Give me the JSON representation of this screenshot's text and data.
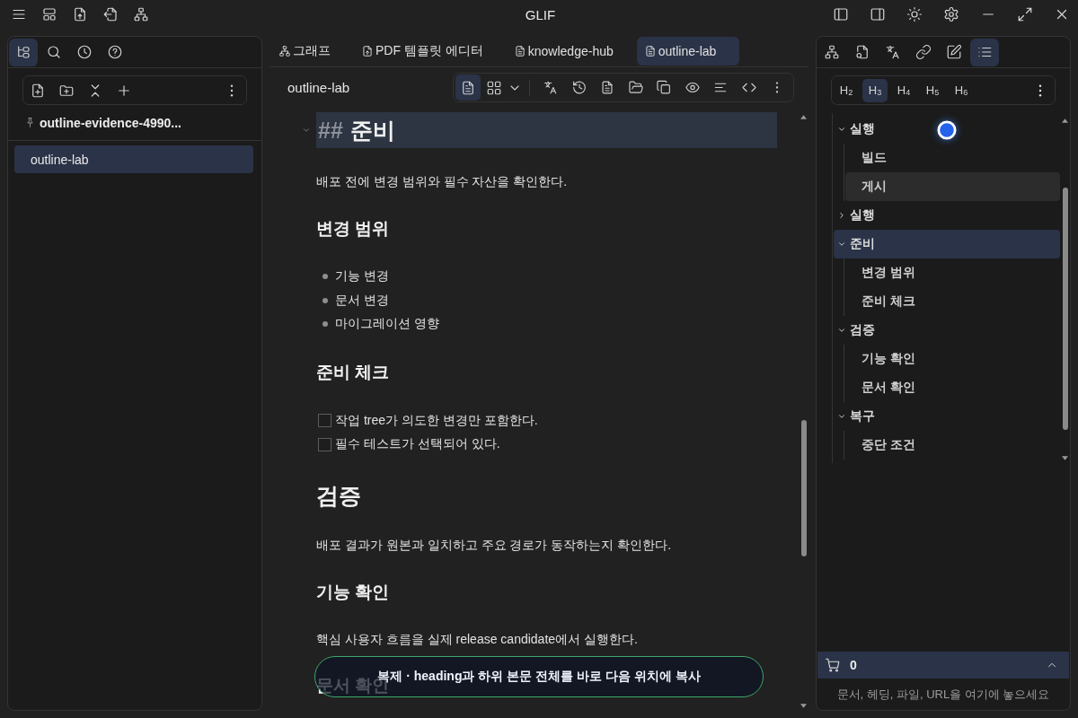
{
  "window": {
    "title": "GLIF"
  },
  "left_panel": {
    "tabs": [
      {
        "selected": true
      },
      {
        "selected": false
      },
      {
        "selected": false
      },
      {
        "selected": false
      }
    ],
    "pinned": "outline-evidence-4990...",
    "files": [
      {
        "label": "outline-lab",
        "selected": true
      }
    ]
  },
  "editor_tabs": [
    {
      "label": "그래프",
      "selected": false
    },
    {
      "label": "PDF 템플릿 에디터",
      "selected": false
    },
    {
      "label": "knowledge-hub",
      "selected": false
    },
    {
      "label": "outline-lab",
      "selected": true
    }
  ],
  "editor": {
    "title": "outline-lab",
    "view_modes": [
      {
        "selected": true
      },
      {
        "selected": false
      }
    ],
    "blocks": [
      {
        "kind": "h2",
        "marker": "##",
        "text": "준비",
        "active": true
      },
      {
        "kind": "paragraph",
        "text": "배포 전에 변경 범위와 필수 자산을 확인한다."
      },
      {
        "kind": "h3",
        "text": "변경 범위",
        "active": false
      },
      {
        "kind": "bullets",
        "items": [
          "기능 변경",
          "문서 변경",
          "마이그레이션 영향"
        ]
      },
      {
        "kind": "h3",
        "text": "준비 체크",
        "active": false
      },
      {
        "kind": "tasks",
        "items": [
          {
            "text": "작업 tree가 의도한 변경만 포함한다.",
            "checked": false
          },
          {
            "text": "필수 테스트가 선택되어 있다.",
            "checked": false
          }
        ]
      },
      {
        "kind": "h2",
        "text": "검증",
        "active": false
      },
      {
        "kind": "paragraph",
        "text": "배포 결과가 원본과 일치하고 주요 경로가 동작하는지 확인한다."
      },
      {
        "kind": "h3",
        "text": "기능 확인",
        "active": false
      },
      {
        "kind": "paragraph",
        "text": "핵심 사용자 흐름을 실제 release candidate에서 실행한다."
      },
      {
        "kind": "h3",
        "text": "문서 확인",
        "active": false
      }
    ]
  },
  "toast": {
    "text": "복제 · heading과 하위 본문 전체를 바로 다음 위치에 복사"
  },
  "right_panel": {
    "tabs": [
      {
        "selected": false
      },
      {
        "selected": false
      },
      {
        "selected": false
      },
      {
        "selected": false
      },
      {
        "selected": false
      },
      {
        "selected": true
      }
    ],
    "heading_levels": [
      {
        "label": "H$_{2}$",
        "selected": false
      },
      {
        "label": "H$_{3}$",
        "selected": true
      },
      {
        "label": "H$_{4}$",
        "selected": false
      },
      {
        "label": "H$_{5}$",
        "selected": false
      },
      {
        "label": "H$_{6}$",
        "selected": false
      }
    ],
    "outline": [
      {
        "label": "실행",
        "expanded": true,
        "selected": false,
        "hovered": false,
        "children": [
          {
            "label": "빌드",
            "selected": false,
            "hovered": false
          },
          {
            "label": "게시",
            "selected": false,
            "hovered": true
          }
        ]
      },
      {
        "label": "실행",
        "expanded": false,
        "selected": false,
        "hovered": false
      },
      {
        "label": "준비",
        "expanded": true,
        "selected": true,
        "hovered": false,
        "children": [
          {
            "label": "변경 범위",
            "selected": false,
            "hovered": false
          },
          {
            "label": "준비 체크",
            "selected": false,
            "hovered": false
          }
        ]
      },
      {
        "label": "검증",
        "expanded": true,
        "selected": false,
        "hovered": false,
        "children": [
          {
            "label": "기능 확인",
            "selected": false,
            "hovered": false
          },
          {
            "label": "문서 확인",
            "selected": false,
            "hovered": false
          }
        ]
      },
      {
        "label": "복구",
        "expanded": true,
        "selected": false,
        "hovered": false,
        "children": [
          {
            "label": "중단 조건",
            "selected": false,
            "hovered": false
          }
        ]
      }
    ],
    "tray": {
      "count": "0",
      "hint": "문서, 헤딩, 파일, URL을 여기에 놓으세요"
    }
  }
}
